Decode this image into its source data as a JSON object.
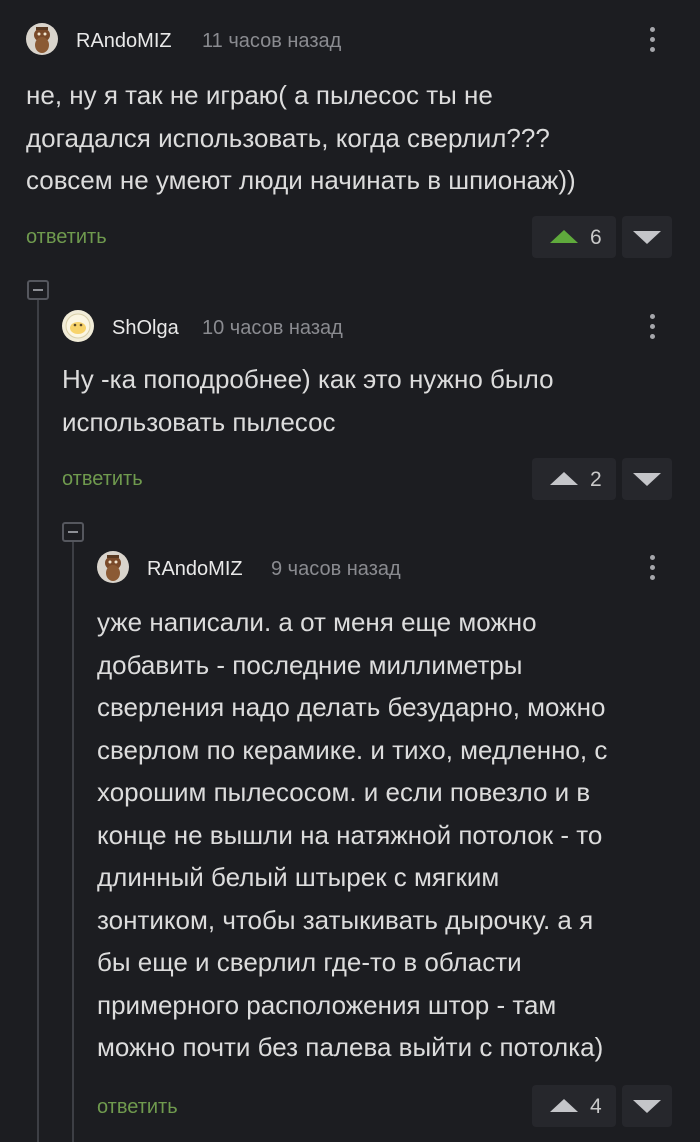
{
  "comments": [
    {
      "author": "RAndoMIZ",
      "time": "11 часов назад",
      "text": "не, ну я так не играю( а пылесос ты не\nдогадался использовать, когда сверлил???\nсовсем не умеют люди начинать в шпионаж))",
      "reply_label": "ответить",
      "votes": "6",
      "upvote_color": "#5faa3c"
    },
    {
      "author": "ShOlga",
      "time": "10 часов назад",
      "text": "Ну -ка поподробнее) как это нужно было\nиспользовать пылесос",
      "reply_label": "ответить",
      "votes": "2",
      "upvote_color": "#c4c5c9"
    },
    {
      "author": "RAndoMIZ",
      "time": "9 часов назад",
      "text": "уже написали. а от меня еще можно\nдобавить - последние миллиметры\nсверления надо делать безударно, можно\nсверлом по керамике. и тихо, медленно, с\nхорошим пылесосом. и если повезло и в\nконце не вышли на натяжной потолок - то\nдлинный белый штырек с мягким\nзонтиком, чтобы затыкивать дырочку. а я\nбы еще и сверлил где-то в области\nпримерного расположения штор - там\nможно почти без палева выйти с потолка)",
      "reply_label": "ответить",
      "votes": "4",
      "upvote_color": "#c4c5c9"
    }
  ],
  "icons": {
    "more": "kebab-menu-icon",
    "upvote": "triangle-up-icon",
    "downvote": "triangle-down-icon",
    "collapse": "minus-box-icon"
  },
  "colors": {
    "background": "#1c1d21",
    "reply_link": "#6f9a4e",
    "upvote_active": "#5faa3c"
  }
}
